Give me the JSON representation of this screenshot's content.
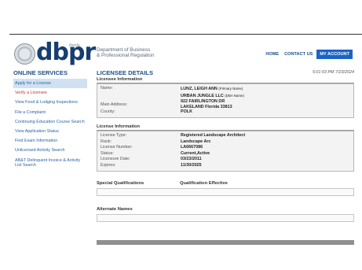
{
  "header": {
    "logo_state": "florida",
    "logo_text": "dbpr",
    "agency_line1": "Department of Business",
    "agency_line2": "& Professional Regulation",
    "nav": {
      "home": "HOME",
      "contact": "CONTACT US",
      "account": "MY ACCOUNT"
    },
    "colors": {
      "brand": "#163e70",
      "account_bg": "#1a64c8"
    }
  },
  "sidebar": {
    "title": "ONLINE SERVICES",
    "items": [
      {
        "label": "Apply for a License"
      },
      {
        "label": "Verify a Licensee"
      },
      {
        "label": "View Food & Lodging Inspections"
      },
      {
        "label": "File a Complaint"
      },
      {
        "label": "Continuing Education Course Search"
      },
      {
        "label": "View Application Status"
      },
      {
        "label": "Find Exam Information"
      },
      {
        "label": "Unlicensed Activity Search"
      },
      {
        "label": "AB&T Delinquent Invoice & Activity List Search"
      }
    ]
  },
  "main": {
    "title": "LICENSEE DETAILS",
    "timestamp": "5:01:03 PM 7/23/2024",
    "licensee_info": {
      "heading": "Licensee Information",
      "name_label": "Name:",
      "name_value": "LUNZ, LEIGH ANN",
      "name_note": "(Primary Name)",
      "dba_value": "URBAN JUNGLE LLC",
      "dba_note": "(DBA Name)",
      "address_label": "Main Address:",
      "address_line1": "922 FAIRLINGTON DR",
      "address_line2": "LAKELAND  Florida  33813",
      "county_label": "County:",
      "county_value": "POLK"
    },
    "license_info": {
      "heading": "License Information",
      "rows": [
        {
          "label": "License Type:",
          "value": "Registered Landscape Architect"
        },
        {
          "label": "Rank:",
          "value": "Landscape Arc"
        },
        {
          "label": "License Number:",
          "value": "LA6667086"
        },
        {
          "label": "Status:",
          "value": "Current,Active"
        },
        {
          "label": "Licensure Date:",
          "value": "03/23/2011"
        },
        {
          "label": "Expires:",
          "value": "11/30/2025"
        }
      ]
    },
    "special_qualifications": {
      "col1": "Special Qualifications",
      "col2": "Qualification Effective"
    },
    "alternate_names": {
      "heading": "Alternate Names"
    }
  }
}
